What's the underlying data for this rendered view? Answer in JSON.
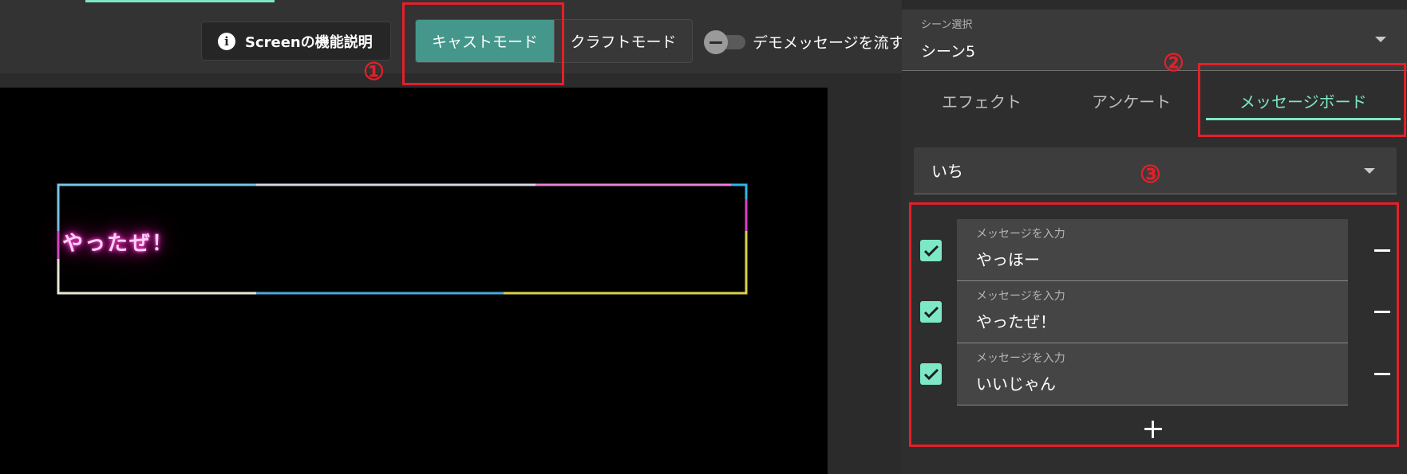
{
  "toolbar": {
    "info_button_label": "Screenの機能説明",
    "cast_mode_label": "キャストモード",
    "craft_mode_label": "クラフトモード",
    "demo_toggle_label": "デモメッセージを流す",
    "demo_toggle_on": false
  },
  "preview": {
    "neon_text": "やったぜ！"
  },
  "scene": {
    "label": "シーン選択",
    "value": "シーン5"
  },
  "tabs": [
    {
      "label": "エフェクト",
      "active": false
    },
    {
      "label": "アンケート",
      "active": false
    },
    {
      "label": "メッセージボード",
      "active": true
    }
  ],
  "board": {
    "selected": "いち",
    "messages": [
      {
        "label": "メッセージを入力",
        "value": "やっほー",
        "checked": true
      },
      {
        "label": "メッセージを入力",
        "value": "やったぜ！",
        "checked": true
      },
      {
        "label": "メッセージを入力",
        "value": "いいじゃん",
        "checked": true
      }
    ]
  },
  "annotations": [
    "①",
    "②",
    "③"
  ],
  "colors": {
    "accent": "#7de8c6",
    "cast_mode_active": "#44978a",
    "annotation_red": "#e3202a",
    "neon_pink": "#ff33cc"
  },
  "icons": [
    "info-icon",
    "chevron-down-icon",
    "check-icon",
    "minus-icon",
    "plus-icon"
  ]
}
